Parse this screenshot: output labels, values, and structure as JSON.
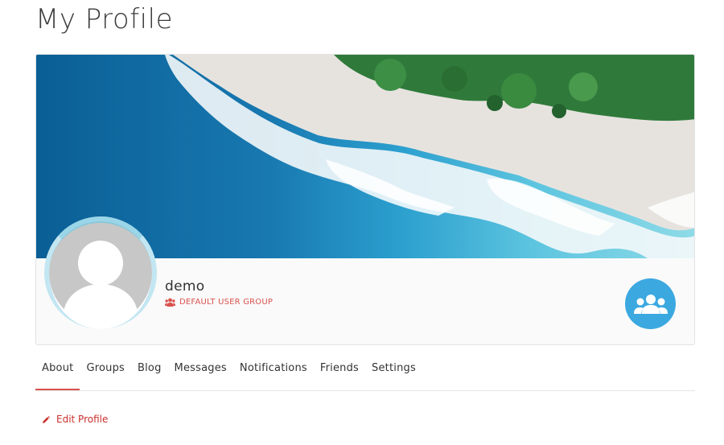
{
  "page": {
    "title": "My Profile"
  },
  "profile": {
    "username": "demo",
    "group_label": "DEFAULT USER GROUP",
    "group_icon": "users-icon",
    "badge_icon": "group-icon",
    "cover_image": "beach aerial cover photo",
    "avatar": "default-avatar-silhouette"
  },
  "tabs": [
    {
      "label": "About",
      "active": true
    },
    {
      "label": "Groups"
    },
    {
      "label": "Blog"
    },
    {
      "label": "Messages"
    },
    {
      "label": "Notifications"
    },
    {
      "label": "Friends"
    },
    {
      "label": "Settings"
    }
  ],
  "actions": {
    "edit_profile": "Edit Profile",
    "edit_icon": "pencil-icon"
  },
  "colors": {
    "accent": "#d9534f",
    "badge": "#3ba8e0",
    "title": "#3d3d3d"
  }
}
